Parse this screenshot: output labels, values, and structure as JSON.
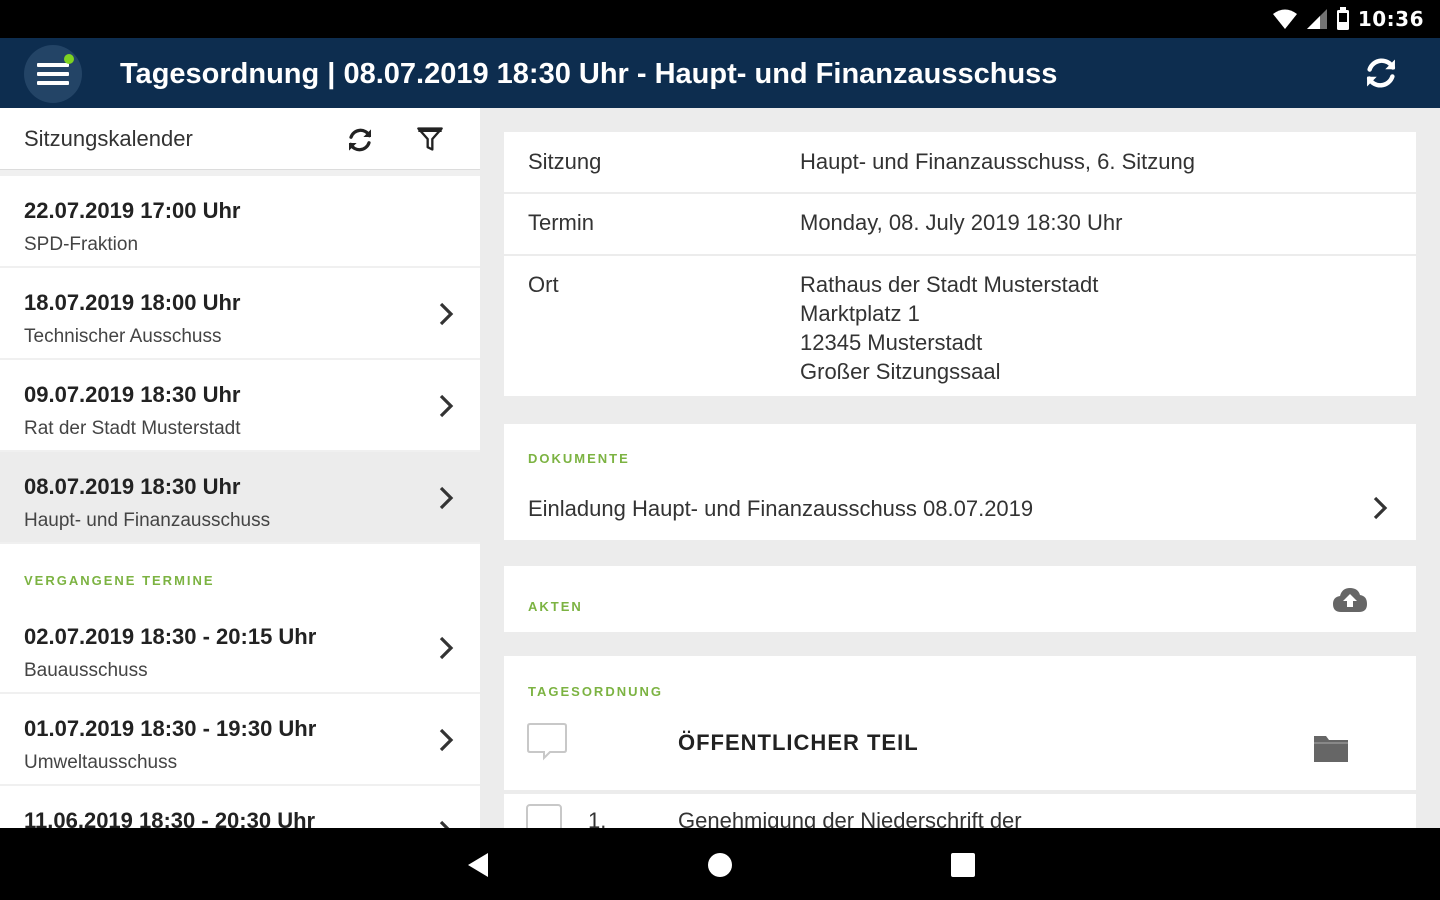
{
  "status_bar": {
    "time": "10:36"
  },
  "app_bar": {
    "title": "Tagesordnung | 08.07.2019 18:30 Uhr - Haupt- und Finanzausschuss"
  },
  "left_panel": {
    "header_title": "Sitzungskalender",
    "upcoming": [
      {
        "date": "22.07.2019 17:00 Uhr",
        "name": "SPD-Fraktion"
      },
      {
        "date": "18.07.2019 18:00 Uhr",
        "name": "Technischer Ausschuss"
      },
      {
        "date": "09.07.2019 18:30 Uhr",
        "name": "Rat der Stadt Musterstadt"
      },
      {
        "date": "08.07.2019 18:30 Uhr",
        "name": "Haupt- und Finanzausschuss"
      }
    ],
    "past_label": "VERGANGENE TERMINE",
    "past": [
      {
        "date": "02.07.2019 18:30 - 20:15 Uhr",
        "name": "Bauausschuss"
      },
      {
        "date": "01.07.2019 18:30 - 19:30 Uhr",
        "name": "Umweltausschuss"
      },
      {
        "date": "11.06.2019 18:30 - 20:30 Uhr",
        "name": ""
      }
    ]
  },
  "details": {
    "sitzung_label": "Sitzung",
    "sitzung_value": "Haupt- und Finanzausschuss, 6. Sitzung",
    "termin_label": "Termin",
    "termin_value": "Monday, 08. July 2019 18:30 Uhr",
    "ort_label": "Ort",
    "ort_lines": [
      "Rathaus der Stadt Musterstadt",
      "Marktplatz 1",
      "12345 Musterstadt",
      "Großer Sitzungssaal"
    ]
  },
  "documents": {
    "label": "DOKUMENTE",
    "item": "Einladung Haupt- und Finanzausschuss 08.07.2019"
  },
  "akten": {
    "label": "AKTEN"
  },
  "agenda": {
    "label": "TAGESORDNUNG",
    "section_title": "ÖFFENTLICHER TEIL",
    "items": [
      {
        "number": "1.",
        "title": "Genehmigung der Niederschrift der"
      }
    ]
  },
  "colors": {
    "app_bar": "#0d2d4f",
    "accent_green": "#7cb342"
  }
}
